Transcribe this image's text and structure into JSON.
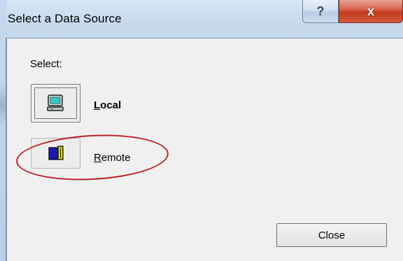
{
  "window": {
    "title": "Select a Data Source",
    "help_glyph": "?",
    "close_glyph": "x"
  },
  "dialog": {
    "select_label": "Select:",
    "local": {
      "prefix": "",
      "mnemonic": "L",
      "rest": "ocal",
      "icon": "computer-icon"
    },
    "remote": {
      "prefix": "",
      "mnemonic": "R",
      "rest": "emote",
      "icon": "remote-book-icon"
    },
    "close_label": "Close"
  },
  "annotation": {
    "color": "#c0202a"
  }
}
